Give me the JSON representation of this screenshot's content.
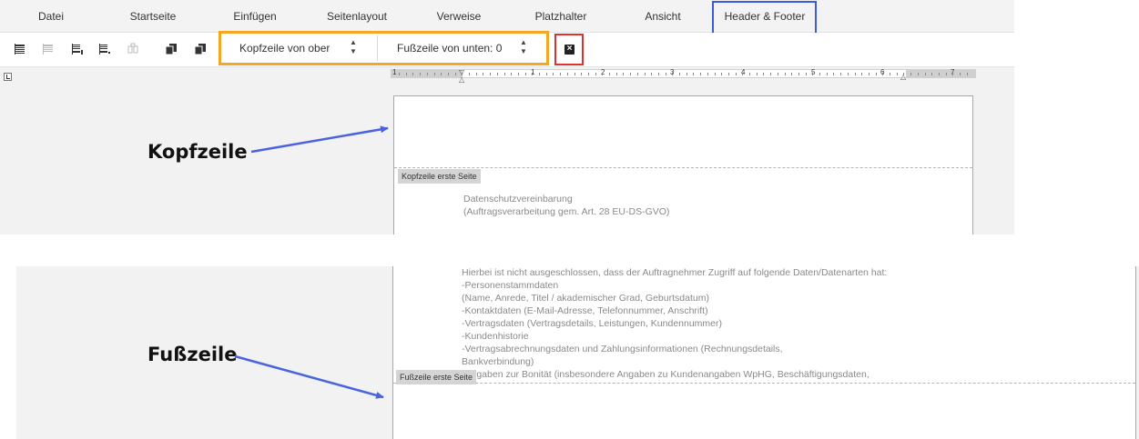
{
  "menu": {
    "items": [
      "Datei",
      "Startseite",
      "Einfügen",
      "Seitenlayout",
      "Verweise",
      "Platzhalter",
      "Ansicht",
      "Header & Footer"
    ]
  },
  "toolbar": {
    "icons": [
      "header-icon",
      "header-disabled-icon",
      "footer-insert-icon",
      "footer-edit-icon",
      "link-previous-icon",
      "copy-pages-icon",
      "paste-pages-icon"
    ],
    "header_offset_label": "Kopfzeile von ober",
    "footer_offset_label": "Fußzeile von unten: 0",
    "close_icon": "close-header-footer-icon"
  },
  "ruler": {
    "numbers": [
      "1",
      "1",
      "2",
      "3",
      "4",
      "5",
      "6",
      "7"
    ]
  },
  "document": {
    "header_tag": "Kopfzeile erste Seite",
    "footer_tag": "Fußzeile erste Seite",
    "title_lines": [
      "Datenschutzvereinbarung",
      "(Auftragsverarbeitung gem. Art. 28 EU-DS-GVO)"
    ],
    "body_lines": [
      "Hierbei ist nicht ausgeschlossen, dass der Auftragnehmer Zugriff auf folgende Daten/Datenarten hat:",
      "-Personenstammdaten",
      "(Name, Anrede, Titel / akademischer Grad, Geburtsdatum)",
      "-Kontaktdaten (E-Mail-Adresse, Telefonnummer, Anschrift)",
      "-Vertragsdaten (Vertragsdetails, Leistungen, Kundennummer)",
      "-Kundenhistorie",
      "-Vertragsabrechnungsdaten und Zahlungsinformationen (Rechnungsdetails,",
      "Bankverbindung)",
      "-Angaben zur Bonität (insbesondere Angaben zu Kundenangaben WpHG, Beschäftigungsdaten,"
    ]
  },
  "annotations": {
    "header_callout": "Kopfzeile",
    "footer_callout": "Fußzeile"
  },
  "colors": {
    "highlight_blue": "#3b5bdb",
    "highlight_orange": "#f5a623",
    "highlight_red": "#e03131",
    "arrow_blue": "#4a63e0"
  }
}
